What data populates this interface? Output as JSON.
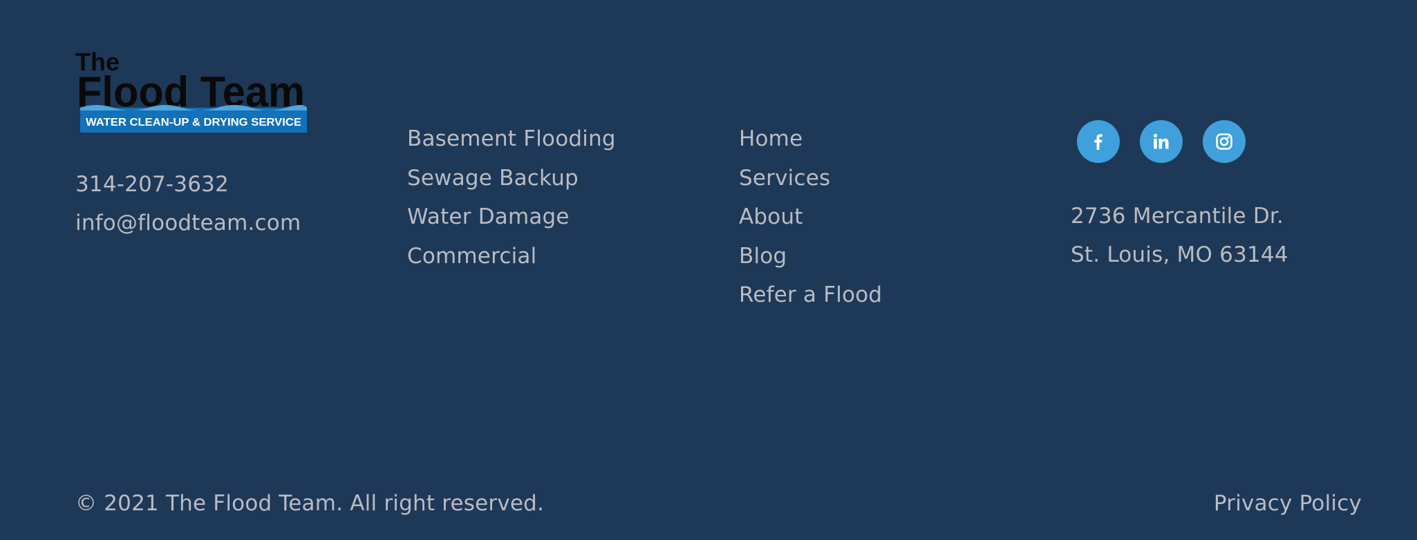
{
  "logo": {
    "line1": "The",
    "line2": "Flood Team",
    "tagline": "WATER CLEAN-UP & DRYING SERVICE",
    "colors": {
      "text": "#0a0a0a",
      "banner": "#1271b8",
      "wave": "#4fa6dd",
      "tagline_text": "#ffffff"
    }
  },
  "contact": {
    "phone": "314-207-3632",
    "email": "info@floodteam.com"
  },
  "services": [
    {
      "label": "Basement Flooding"
    },
    {
      "label": "Sewage Backup"
    },
    {
      "label": "Water Damage"
    },
    {
      "label": "Commercial"
    }
  ],
  "nav": [
    {
      "label": "Home"
    },
    {
      "label": "Services"
    },
    {
      "label": "About"
    },
    {
      "label": "Blog"
    },
    {
      "label": "Refer a Flood"
    }
  ],
  "social": [
    {
      "name": "facebook-icon",
      "glyph": "f"
    },
    {
      "name": "linkedin-icon",
      "glyph": "in"
    },
    {
      "name": "instagram-icon",
      "glyph": ""
    }
  ],
  "address": {
    "line1": "2736 Mercantile Dr.",
    "line2": "St. Louis, MO 63144"
  },
  "footer": {
    "copyright": "© 2021 The Flood Team. All right reserved.",
    "privacy": "Privacy Policy"
  },
  "colors": {
    "background": "#1e3858",
    "text": "#b9bcc2",
    "social_bg": "#3fa0dc"
  }
}
